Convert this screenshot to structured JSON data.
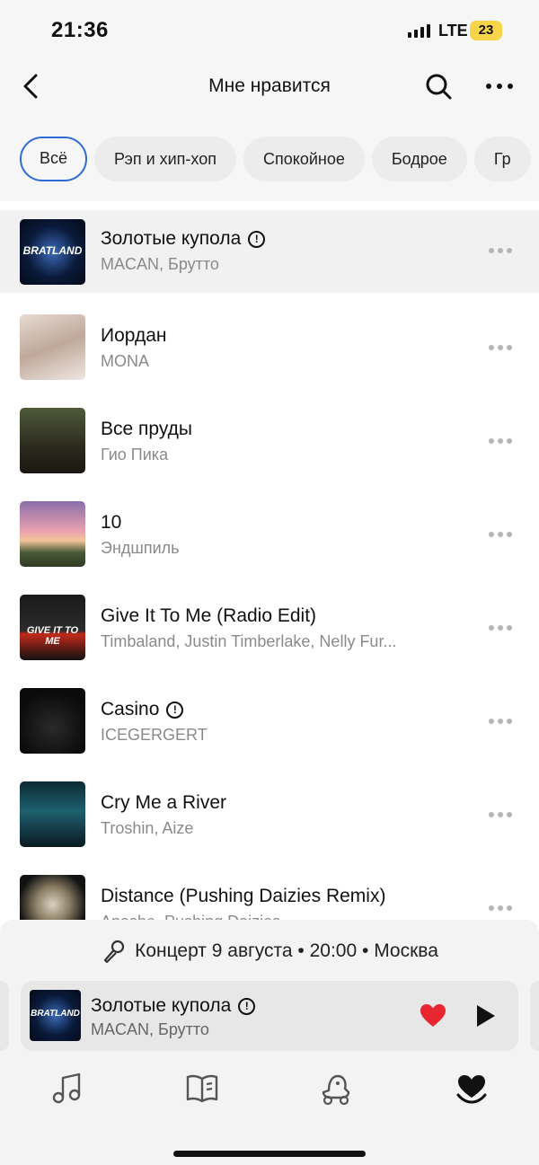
{
  "status_bar": {
    "time": "21:36",
    "network": "LTE",
    "battery": "23"
  },
  "header": {
    "title": "Мне нравится",
    "back_icon": "chevron-left-icon",
    "search_icon": "search-icon",
    "more_icon": "more-horizontal-icon"
  },
  "filters": [
    {
      "label": "Всё",
      "active": true
    },
    {
      "label": "Рэп и хип-хоп"
    },
    {
      "label": "Спокойное"
    },
    {
      "label": "Бодрое"
    },
    {
      "label": "Гр"
    }
  ],
  "tracks": [
    {
      "title": "Золотые купола",
      "artist": "MACAN, Брутто",
      "explicit": true,
      "cover_text": "BRATLAND"
    },
    {
      "title": "Иордан",
      "artist": "MONA",
      "explicit": false
    },
    {
      "title": "Все пруды",
      "artist": "Гио Пика",
      "explicit": false
    },
    {
      "title": "10",
      "artist": "Эндшпиль",
      "explicit": false
    },
    {
      "title": "Give It To Me (Radio Edit)",
      "artist": "Timbaland, Justin Timberlake, Nelly Fur...",
      "explicit": false,
      "cover_text": "GIVE IT TO ME"
    },
    {
      "title": "Casino",
      "artist": "ICEGERGERT",
      "explicit": true
    },
    {
      "title": "Cry Me a River",
      "artist": "Troshin, Aize",
      "explicit": false
    },
    {
      "title": "Distance (Pushing Daizies Remix)",
      "artist": "Apashe, Pushing Daizies",
      "explicit": false
    }
  ],
  "explicit_mark": "!",
  "concert": {
    "text": "Концерт 9 августа • 20:00 • Москва",
    "icon": "microphone-icon"
  },
  "mini_player": {
    "title": "Золотые купола",
    "artist": "MACAN, Брутто",
    "explicit": true,
    "cover_text": "BRATLAND",
    "liked": true
  },
  "colors": {
    "accent": "#2f6bd6",
    "heart": "#e8262f",
    "battery": "#f7d54a"
  },
  "tabs": [
    {
      "name": "music-note-icon"
    },
    {
      "name": "book-icon"
    },
    {
      "name": "kids-icon"
    },
    {
      "name": "heart-icon",
      "active": true
    }
  ]
}
